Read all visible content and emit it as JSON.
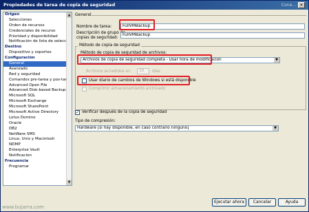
{
  "window": {
    "title": "Propiedades de tarea de copia de seguridad",
    "title_right_text": "Cone...",
    "close_glyph": "✕"
  },
  "sidebar": {
    "items": [
      {
        "label": "Origen",
        "head": true
      },
      {
        "label": "Selecciones"
      },
      {
        "label": "Orden de recursos"
      },
      {
        "label": "Credenciales de recurso"
      },
      {
        "label": "Prioridad y disponibilidad"
      },
      {
        "label": "Notificación de lista de selección"
      },
      {
        "label": "Destino",
        "head": true
      },
      {
        "label": "Dispositivo y soportes"
      },
      {
        "label": "Configuración",
        "head": true
      },
      {
        "label": "General",
        "selected": true
      },
      {
        "label": "Avanzado"
      },
      {
        "label": "Red y seguridad"
      },
      {
        "label": "Comandos pre-tarea y pos-tarea"
      },
      {
        "label": "Advanced Open File"
      },
      {
        "label": "Advanced Disk-based Backup"
      },
      {
        "label": "Microsoft SQL"
      },
      {
        "label": "Microsoft Exchange"
      },
      {
        "label": "Microsoft SharePoint"
      },
      {
        "label": "Microsoft Active Directory"
      },
      {
        "label": "Lotus Domino"
      },
      {
        "label": "Oracle"
      },
      {
        "label": "DB2"
      },
      {
        "label": "NetWare SMS"
      },
      {
        "label": "Linux, Unix y Macintosh"
      },
      {
        "label": "NDMP"
      },
      {
        "label": "Enterprise Vault"
      },
      {
        "label": "Notificación"
      },
      {
        "label": "Frecuencia",
        "head": true
      },
      {
        "label": "Programar"
      }
    ]
  },
  "general": {
    "section_title": "General",
    "job_name_label": "Nombre de tarea:",
    "job_name_value": "FullVMBackup",
    "group_desc_label_1": "Descripción de grupo de",
    "group_desc_label_2": "copias de seguridad:",
    "group_desc_value": "FullVMBackup"
  },
  "method": {
    "group_title": "Método de copia de seguridad",
    "files_method_label": "Método de copia de seguridad de archivos:",
    "files_method_value": "Archivos de copia de seguridad completa - Usar hora de modificación",
    "accessed_label": "Archivos accedidos en",
    "accessed_value": "30",
    "accessed_unit": "días",
    "change_journal_label": "Usar diario de cambios de Windows si está disponible",
    "change_journal_checked": false,
    "compress_label": "Comprimir almacenamiento archivado",
    "compress_checked": false
  },
  "verify": {
    "label": "Verificar después de la copia de seguridad",
    "checked": true
  },
  "compression": {
    "label": "Tipo de compresión:",
    "value": "Hardware [si hay disponible, en caso contrario ninguno]"
  },
  "buttons": {
    "run_now": "Ejecutar ahora",
    "cancel": "Cancelar",
    "help": "Ayuda"
  },
  "watermark": "www.bujarra.com",
  "colors": {
    "highlight": "#e01b24",
    "selection": "#316ac5",
    "titlebar": "#0a246a"
  }
}
